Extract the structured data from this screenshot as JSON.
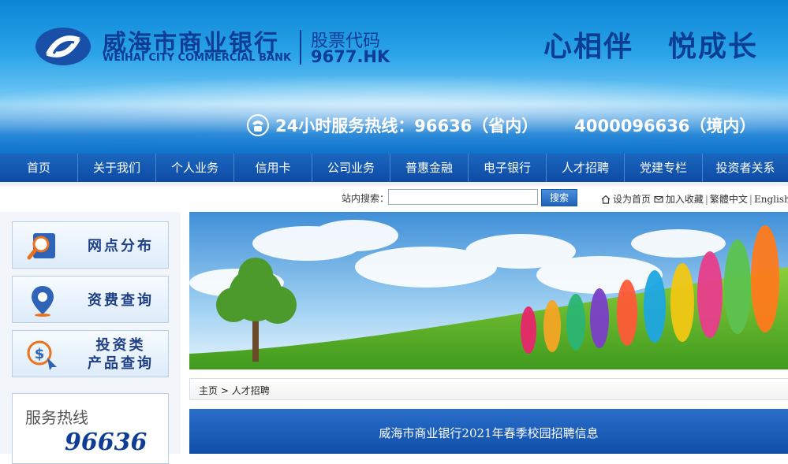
{
  "header": {
    "bank_name_cn": "威海市商业银行",
    "bank_name_en": "WEIHAI CITY COMMERCIAL BANK",
    "stock_label": "股票代码",
    "stock_code": "9677.HK",
    "slogan_1": "心相伴",
    "slogan_2": "悦成长",
    "hotline_label": "24小时服务热线：",
    "hotline_domestic": "96636（省内）",
    "hotline_national": "4000096636（境内）",
    "icons": {
      "logo": "bank-logo",
      "phone": "phone-icon"
    },
    "colors": {
      "brand": "#0d3d95",
      "sky": "#2aa3e8"
    }
  },
  "nav": {
    "items": [
      {
        "label": "首页"
      },
      {
        "label": "关于我们"
      },
      {
        "label": "个人业务"
      },
      {
        "label": "信用卡"
      },
      {
        "label": "公司业务"
      },
      {
        "label": "普惠金融"
      },
      {
        "label": "电子银行"
      },
      {
        "label": "人才招聘"
      },
      {
        "label": "党建专栏"
      },
      {
        "label": "投资者关系"
      }
    ]
  },
  "search": {
    "label": "站内搜索：",
    "placeholder": "",
    "value": "",
    "button": "搜索"
  },
  "toplinks": {
    "homepage": "设为首页",
    "favorite": "加入收藏",
    "traditional": "繁體中文",
    "english": "English"
  },
  "sidebar": {
    "buttons": [
      {
        "label": "网点分布",
        "icon": "map-search-icon"
      },
      {
        "label": "资费查询",
        "icon": "location-pin-icon"
      },
      {
        "label_line1": "投资类",
        "label_line2": "产品查询",
        "icon": "investment-dollar-icon"
      }
    ],
    "hotline": {
      "title": "服务热线",
      "number": "96636"
    }
  },
  "breadcrumb": {
    "home": "主页",
    "separator": ">",
    "current": "人才招聘"
  },
  "content": {
    "title": "威海市商业银行2021年春季校园招聘信息"
  }
}
